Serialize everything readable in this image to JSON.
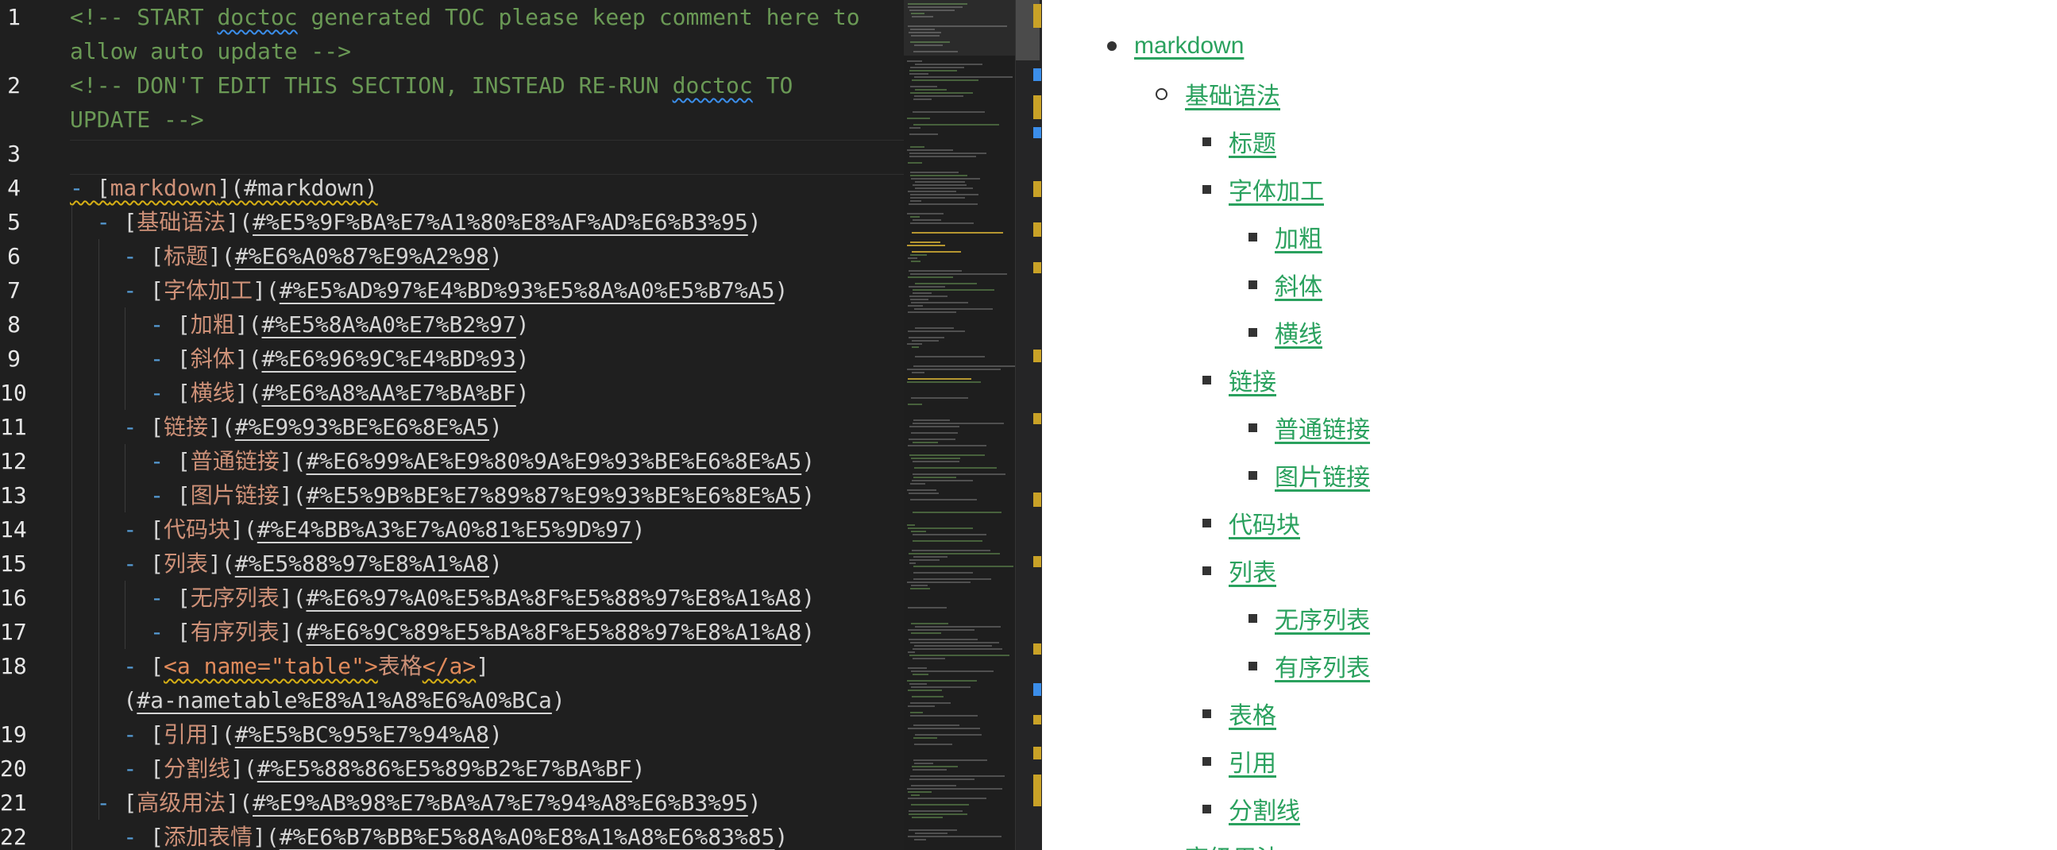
{
  "editor": {
    "line_numbers": [
      "1",
      "2",
      "3",
      "4",
      "5",
      "6",
      "7",
      "8",
      "9",
      "10",
      "11",
      "12",
      "13",
      "14",
      "15",
      "16",
      "17",
      "18",
      "19",
      "20",
      "21",
      "22"
    ],
    "lines": [
      {
        "parts": [
          {
            "t": "<!-- START ",
            "c": "com"
          },
          {
            "t": "doctoc",
            "c": "com sq"
          },
          {
            "t": " generated TOC please keep comment here to",
            "c": "com"
          }
        ]
      },
      {
        "parts": [
          {
            "t": "allow auto update -->",
            "c": "com"
          }
        ]
      },
      {
        "parts": [
          {
            "t": "<!-- DON'T EDIT THIS SECTION, INSTEAD RE-RUN ",
            "c": "com"
          },
          {
            "t": "doctoc",
            "c": "com sq"
          },
          {
            "t": " TO",
            "c": "com"
          }
        ]
      },
      {
        "parts": [
          {
            "t": "UPDATE -->",
            "c": "com"
          }
        ]
      },
      {
        "parts": []
      },
      {
        "parts": [
          {
            "t": "- ",
            "c": "dash sqy"
          },
          {
            "t": "[",
            "c": "br sqy"
          },
          {
            "t": "markdown",
            "c": "lt sqy"
          },
          {
            "t": "](#markdown)",
            "c": "br sqy"
          }
        ]
      },
      {
        "parts": [
          {
            "t": "  - ",
            "c": "dash"
          },
          {
            "t": "[",
            "c": "br"
          },
          {
            "t": "基础语法",
            "c": "lt"
          },
          {
            "t": "](",
            "c": "br"
          },
          {
            "t": "#%E5%9F%BA%E7%A1%80%E8%AF%AD%E6%B3%95",
            "c": "lu"
          },
          {
            "t": ")",
            "c": "br"
          }
        ]
      },
      {
        "parts": [
          {
            "t": "    - ",
            "c": "dash"
          },
          {
            "t": "[",
            "c": "br"
          },
          {
            "t": "标题",
            "c": "lt"
          },
          {
            "t": "](",
            "c": "br"
          },
          {
            "t": "#%E6%A0%87%E9%A2%98",
            "c": "lu"
          },
          {
            "t": ")",
            "c": "br"
          }
        ]
      },
      {
        "parts": [
          {
            "t": "    - ",
            "c": "dash"
          },
          {
            "t": "[",
            "c": "br"
          },
          {
            "t": "字体加工",
            "c": "lt"
          },
          {
            "t": "](",
            "c": "br"
          },
          {
            "t": "#%E5%AD%97%E4%BD%93%E5%8A%A0%E5%B7%A5",
            "c": "lu"
          },
          {
            "t": ")",
            "c": "br"
          }
        ]
      },
      {
        "parts": [
          {
            "t": "      - ",
            "c": "dash"
          },
          {
            "t": "[",
            "c": "br"
          },
          {
            "t": "加粗",
            "c": "lt"
          },
          {
            "t": "](",
            "c": "br"
          },
          {
            "t": "#%E5%8A%A0%E7%B2%97",
            "c": "lu"
          },
          {
            "t": ")",
            "c": "br"
          }
        ]
      },
      {
        "parts": [
          {
            "t": "      - ",
            "c": "dash"
          },
          {
            "t": "[",
            "c": "br"
          },
          {
            "t": "斜体",
            "c": "lt"
          },
          {
            "t": "](",
            "c": "br"
          },
          {
            "t": "#%E6%96%9C%E4%BD%93",
            "c": "lu"
          },
          {
            "t": ")",
            "c": "br"
          }
        ]
      },
      {
        "parts": [
          {
            "t": "      - ",
            "c": "dash"
          },
          {
            "t": "[",
            "c": "br"
          },
          {
            "t": "横线",
            "c": "lt"
          },
          {
            "t": "](",
            "c": "br"
          },
          {
            "t": "#%E6%A8%AA%E7%BA%BF",
            "c": "lu"
          },
          {
            "t": ")",
            "c": "br"
          }
        ]
      },
      {
        "parts": [
          {
            "t": "    - ",
            "c": "dash"
          },
          {
            "t": "[",
            "c": "br"
          },
          {
            "t": "链接",
            "c": "lt"
          },
          {
            "t": "](",
            "c": "br"
          },
          {
            "t": "#%E9%93%BE%E6%8E%A5",
            "c": "lu"
          },
          {
            "t": ")",
            "c": "br"
          }
        ]
      },
      {
        "parts": [
          {
            "t": "      - ",
            "c": "dash"
          },
          {
            "t": "[",
            "c": "br"
          },
          {
            "t": "普通链接",
            "c": "lt"
          },
          {
            "t": "](",
            "c": "br"
          },
          {
            "t": "#%E6%99%AE%E9%80%9A%E9%93%BE%E6%8E%A5",
            "c": "lu"
          },
          {
            "t": ")",
            "c": "br"
          }
        ]
      },
      {
        "parts": [
          {
            "t": "      - ",
            "c": "dash"
          },
          {
            "t": "[",
            "c": "br"
          },
          {
            "t": "图片链接",
            "c": "lt"
          },
          {
            "t": "](",
            "c": "br"
          },
          {
            "t": "#%E5%9B%BE%E7%89%87%E9%93%BE%E6%8E%A5",
            "c": "lu"
          },
          {
            "t": ")",
            "c": "br"
          }
        ]
      },
      {
        "parts": [
          {
            "t": "    - ",
            "c": "dash"
          },
          {
            "t": "[",
            "c": "br"
          },
          {
            "t": "代码块",
            "c": "lt"
          },
          {
            "t": "](",
            "c": "br"
          },
          {
            "t": "#%E4%BB%A3%E7%A0%81%E5%9D%97",
            "c": "lu"
          },
          {
            "t": ")",
            "c": "br"
          }
        ]
      },
      {
        "parts": [
          {
            "t": "    - ",
            "c": "dash"
          },
          {
            "t": "[",
            "c": "br"
          },
          {
            "t": "列表",
            "c": "lt"
          },
          {
            "t": "](",
            "c": "br"
          },
          {
            "t": "#%E5%88%97%E8%A1%A8",
            "c": "lu"
          },
          {
            "t": ")",
            "c": "br"
          }
        ]
      },
      {
        "parts": [
          {
            "t": "      - ",
            "c": "dash"
          },
          {
            "t": "[",
            "c": "br"
          },
          {
            "t": "无序列表",
            "c": "lt"
          },
          {
            "t": "](",
            "c": "br"
          },
          {
            "t": "#%E6%97%A0%E5%BA%8F%E5%88%97%E8%A1%A8",
            "c": "lu"
          },
          {
            "t": ")",
            "c": "br"
          }
        ]
      },
      {
        "parts": [
          {
            "t": "      - ",
            "c": "dash"
          },
          {
            "t": "[",
            "c": "br"
          },
          {
            "t": "有序列表",
            "c": "lt"
          },
          {
            "t": "](",
            "c": "br"
          },
          {
            "t": "#%E6%9C%89%E5%BA%8F%E5%88%97%E8%A1%A8",
            "c": "lu"
          },
          {
            "t": ")",
            "c": "br"
          }
        ]
      },
      {
        "parts": [
          {
            "t": "    - ",
            "c": "dash"
          },
          {
            "t": "[",
            "c": "br"
          },
          {
            "t": "<a name=\"table\">",
            "c": "tag"
          },
          {
            "t": "表格",
            "c": "lt"
          },
          {
            "t": "</a>",
            "c": "tag"
          },
          {
            "t": "]",
            "c": "br"
          }
        ]
      },
      {
        "parts": [
          {
            "t": "    (",
            "c": "br"
          },
          {
            "t": "#a-nametable%E8%A1%A8%E6%A0%BCa",
            "c": "lu"
          },
          {
            "t": ")",
            "c": "br"
          }
        ]
      },
      {
        "parts": [
          {
            "t": "    - ",
            "c": "dash"
          },
          {
            "t": "[",
            "c": "br"
          },
          {
            "t": "引用",
            "c": "lt"
          },
          {
            "t": "](",
            "c": "br"
          },
          {
            "t": "#%E5%BC%95%E7%94%A8",
            "c": "lu"
          },
          {
            "t": ")",
            "c": "br"
          }
        ]
      },
      {
        "parts": [
          {
            "t": "    - ",
            "c": "dash"
          },
          {
            "t": "[",
            "c": "br"
          },
          {
            "t": "分割线",
            "c": "lt"
          },
          {
            "t": "](",
            "c": "br"
          },
          {
            "t": "#%E5%88%86%E5%89%B2%E7%BA%BF",
            "c": "lu"
          },
          {
            "t": ")",
            "c": "br"
          }
        ]
      },
      {
        "parts": [
          {
            "t": "  - ",
            "c": "dash"
          },
          {
            "t": "[",
            "c": "br"
          },
          {
            "t": "高级用法",
            "c": "lt"
          },
          {
            "t": "](",
            "c": "br"
          },
          {
            "t": "#%E9%AB%98%E7%BA%A7%E7%94%A8%E6%B3%95",
            "c": "lu"
          },
          {
            "t": ")",
            "c": "br"
          }
        ]
      },
      {
        "parts": [
          {
            "t": "    - ",
            "c": "dash"
          },
          {
            "t": "[",
            "c": "br"
          },
          {
            "t": "添加表情",
            "c": "lt"
          },
          {
            "t": "](",
            "c": "br"
          },
          {
            "t": "#%E6%B7%BB%E5%8A%A0%E8%A1%A8%E6%83%85",
            "c": "lu"
          },
          {
            "t": ")",
            "c": "br"
          }
        ]
      }
    ]
  },
  "preview": {
    "items": [
      {
        "label": "markdown",
        "level": 0
      },
      {
        "label": "基础语法",
        "level": 1
      },
      {
        "label": "标题",
        "level": 2
      },
      {
        "label": "字体加工",
        "level": 2
      },
      {
        "label": "加粗",
        "level": 3
      },
      {
        "label": "斜体",
        "level": 3
      },
      {
        "label": "横线",
        "level": 3
      },
      {
        "label": "链接",
        "level": 2
      },
      {
        "label": "普通链接",
        "level": 3
      },
      {
        "label": "图片链接",
        "level": 3
      },
      {
        "label": "代码块",
        "level": 2
      },
      {
        "label": "列表",
        "level": 2
      },
      {
        "label": "无序列表",
        "level": 3
      },
      {
        "label": "有序列表",
        "level": 3
      },
      {
        "label": "表格",
        "level": 2
      },
      {
        "label": "引用",
        "level": 2
      },
      {
        "label": "分割线",
        "level": 2
      },
      {
        "label": "高级用法",
        "level": 1
      }
    ]
  },
  "colors": {
    "editor_bg": "#1f1f1f",
    "comment": "#6a9955",
    "link_text": "#ce9178",
    "preview_link": "#2aa15e"
  }
}
